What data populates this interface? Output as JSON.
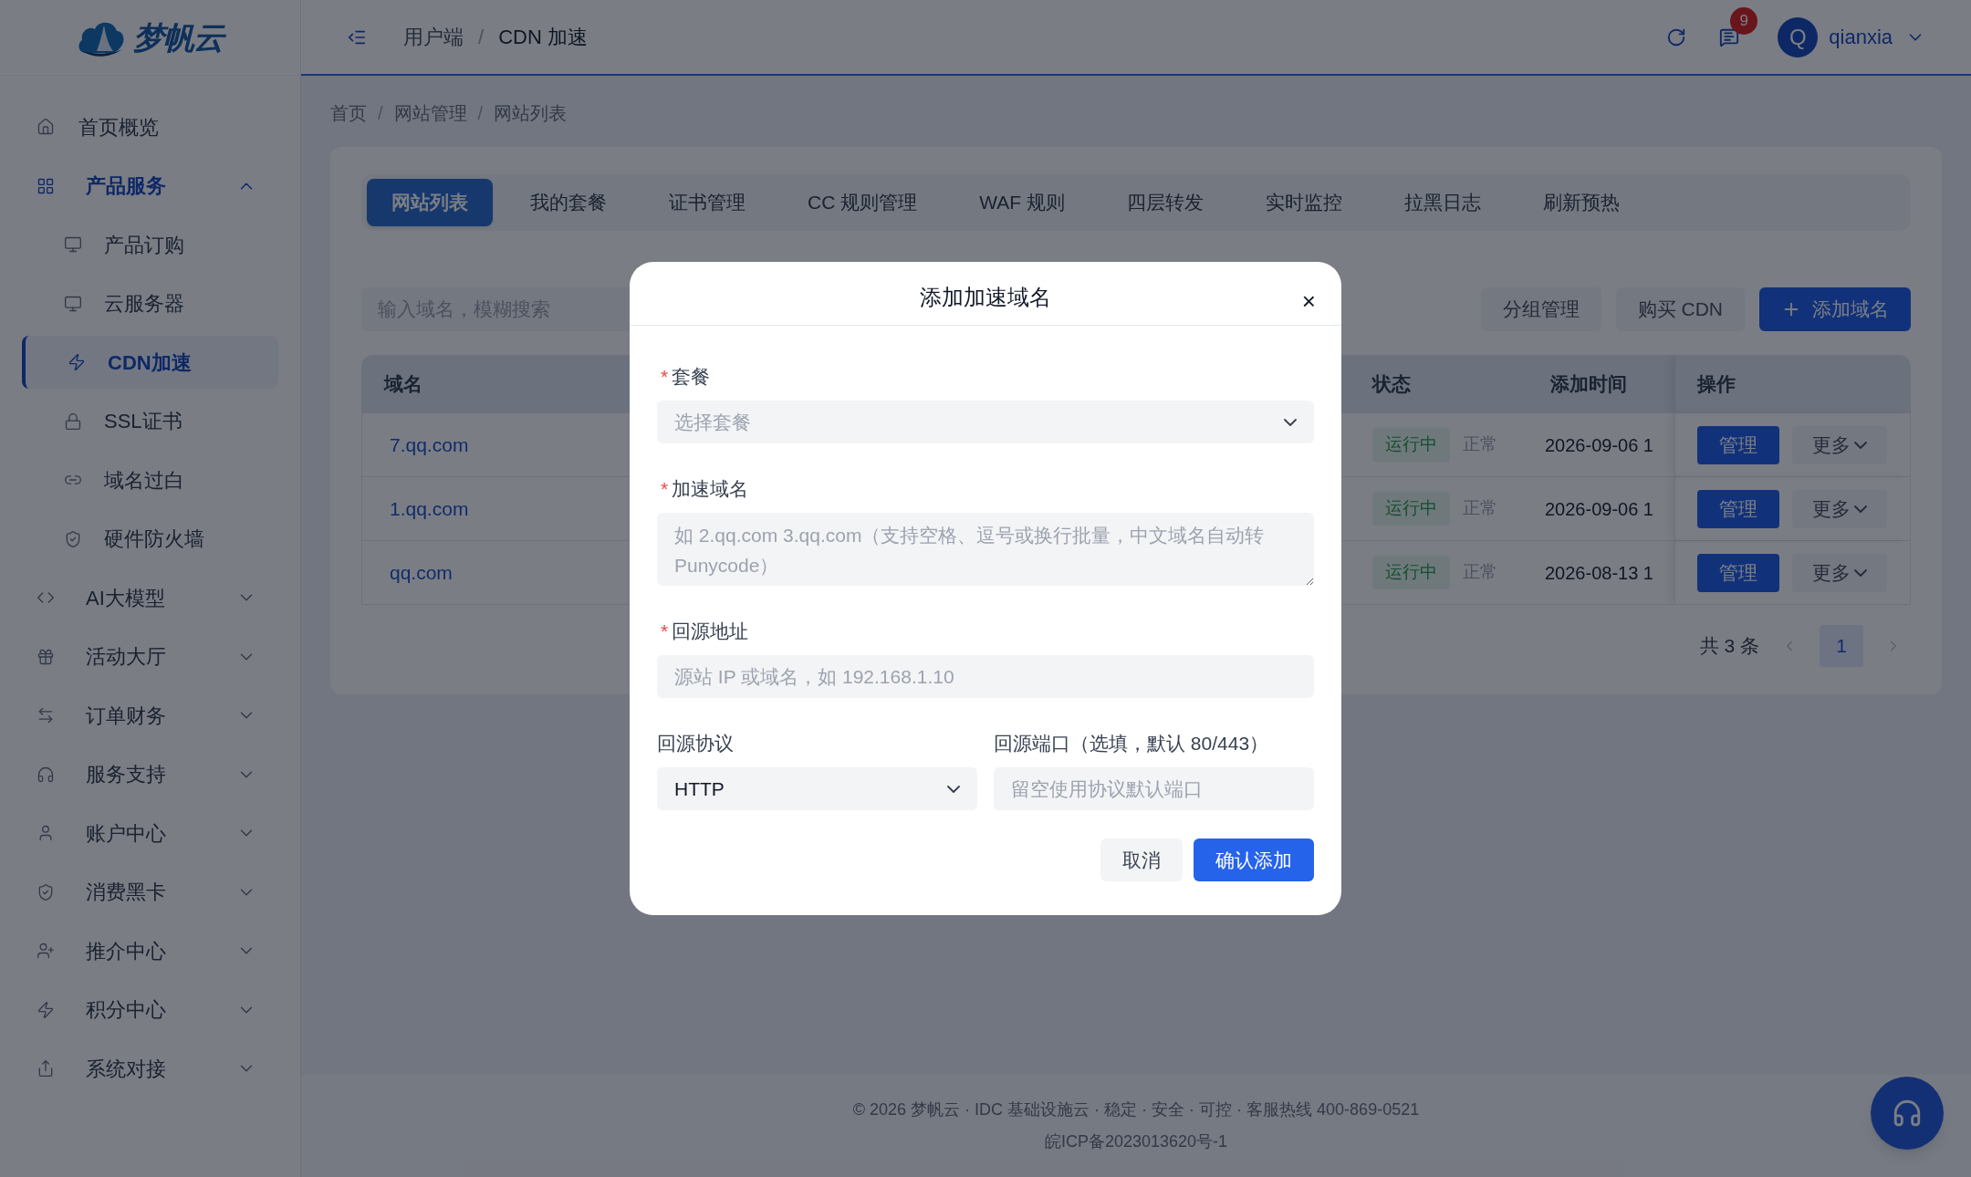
{
  "brand": "梦帆云",
  "breadcrumb_separator": "/",
  "header": {
    "breadcrumb": [
      "用户端",
      "CDN 加速"
    ],
    "notification_count": "9",
    "avatar": "Q",
    "user": "qianxia"
  },
  "sidebar": {
    "items": [
      {
        "label": "首页概览",
        "selected": false
      },
      {
        "label": "产品服务",
        "selected": true,
        "expanded": true,
        "children": [
          {
            "label": "产品订购",
            "selected": false
          },
          {
            "label": "云服务器",
            "selected": false
          },
          {
            "label": "CDN加速",
            "selected": true
          },
          {
            "label": "SSL证书",
            "selected": false
          },
          {
            "label": "域名过白",
            "selected": false
          },
          {
            "label": "硬件防火墙",
            "selected": false
          }
        ]
      },
      {
        "label": "AI大模型",
        "selected": false,
        "expanded": false
      },
      {
        "label": "活动大厅",
        "selected": false,
        "expanded": false
      },
      {
        "label": "订单财务",
        "selected": false,
        "expanded": false
      },
      {
        "label": "服务支持",
        "selected": false,
        "expanded": false
      },
      {
        "label": "账户中心",
        "selected": false,
        "expanded": false
      },
      {
        "label": "消费黑卡",
        "selected": false,
        "expanded": false
      },
      {
        "label": "推介中心",
        "selected": false,
        "expanded": false
      },
      {
        "label": "积分中心",
        "selected": false,
        "expanded": false
      },
      {
        "label": "系统对接",
        "selected": false,
        "expanded": false
      }
    ]
  },
  "page_breadcrumb": [
    "首页",
    "网站管理",
    "网站列表"
  ],
  "tabs": [
    {
      "label": "网站列表",
      "selected": true
    },
    {
      "label": "我的套餐",
      "selected": false
    },
    {
      "label": "证书管理",
      "selected": false
    },
    {
      "label": "CC 规则管理",
      "selected": false
    },
    {
      "label": "WAF 规则",
      "selected": false
    },
    {
      "label": "四层转发",
      "selected": false
    },
    {
      "label": "实时监控",
      "selected": false
    },
    {
      "label": "拉黑日志",
      "selected": false
    },
    {
      "label": "刷新预热",
      "selected": false
    }
  ],
  "search": {
    "placeholder": "输入域名，模糊搜索"
  },
  "toolbar_buttons": [
    {
      "label": "分组管理",
      "kind": "plain"
    },
    {
      "label": "购买 CDN",
      "kind": "plain"
    },
    {
      "label": "添加域名",
      "kind": "primary"
    }
  ],
  "table": {
    "columns": [
      "域名",
      "状态",
      "添加时间",
      "操作"
    ],
    "rows": [
      {
        "domain": "7.qq.com",
        "status": "运行中",
        "state": "正常",
        "added": "2026-09-06 1",
        "actions": [
          "管理",
          "更多"
        ]
      },
      {
        "domain": "1.qq.com",
        "status": "运行中",
        "state": "正常",
        "added": "2026-09-06 1",
        "actions": [
          "管理",
          "更多"
        ]
      },
      {
        "domain": "qq.com",
        "status": "运行中",
        "state": "正常",
        "added": "2026-08-13 1",
        "actions": [
          "管理",
          "更多"
        ]
      }
    ]
  },
  "pagination": {
    "total": "共 3 条",
    "pages": [
      {
        "label": "1",
        "selected": true
      }
    ]
  },
  "footer": [
    "© 2026 梦帆云 · IDC 基础设施云 · 稳定 · 安全 · 可控 · 客服热线 400-869-0521",
    "皖ICP备2023013620号-1"
  ],
  "dialog": {
    "title": "添加加速域名",
    "close": "×",
    "required_symbol": "*",
    "fields": [
      {
        "label": "套餐",
        "required": true,
        "kind": "select",
        "placeholder": "选择套餐"
      },
      {
        "label": "加速域名",
        "required": true,
        "kind": "textarea",
        "placeholder": "如 2.qq.com 3.qq.com（支持空格、逗号或换行批量，中文域名自动转 Punycode）"
      },
      {
        "label": "回源地址",
        "required": true,
        "kind": "input",
        "placeholder": "源站 IP 或域名，如 192.168.1.10"
      }
    ],
    "half_fields": [
      {
        "label": "回源协议",
        "required": false,
        "kind": "select",
        "value": "HTTP"
      },
      {
        "label": "回源端口（选填，默认 80/443）",
        "required": false,
        "kind": "input",
        "placeholder": "留空使用协议默认端口"
      }
    ],
    "buttons": [
      {
        "label": "取消",
        "kind": "plain"
      },
      {
        "label": "确认添加",
        "kind": "primary"
      }
    ]
  }
}
